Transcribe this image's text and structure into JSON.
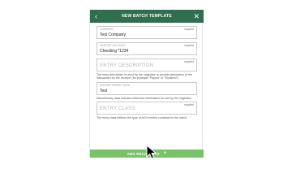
{
  "header": {
    "title": "NEW BATCH TEMPLATE",
    "back_icon": "chevron-left-icon",
    "close_icon": "close-icon"
  },
  "fields": {
    "company": {
      "label": "COMPANY",
      "required": "required",
      "value": "Test Company"
    },
    "deposit": {
      "label": "DEPOSIT ACCOUNT",
      "required": "required",
      "value": "Checking *1234"
    },
    "entry_description": {
      "required": "required",
      "placeholder": "ENTRY DESCRIPTION",
      "helper": "The entry description is used by the originator to provide description of the transaction for the receiver (for example \"Payroll\" or \"Dividend\")"
    },
    "discretionary": {
      "label": "DISCRETIONARY DATA",
      "value": "Test",
      "helper": "Discretionary data includes reference information for use by the originator"
    },
    "entry_class": {
      "required": "required",
      "placeholder": "ENTRY CLASS",
      "helper": "The entry class defines the type of ACH entries contained in the batch."
    }
  },
  "footer": {
    "add_label": "ADD RECIPIENTS",
    "add_icon": "plus-icon"
  },
  "colors": {
    "header": "#2f6e4f",
    "button": "#7ac26a"
  }
}
